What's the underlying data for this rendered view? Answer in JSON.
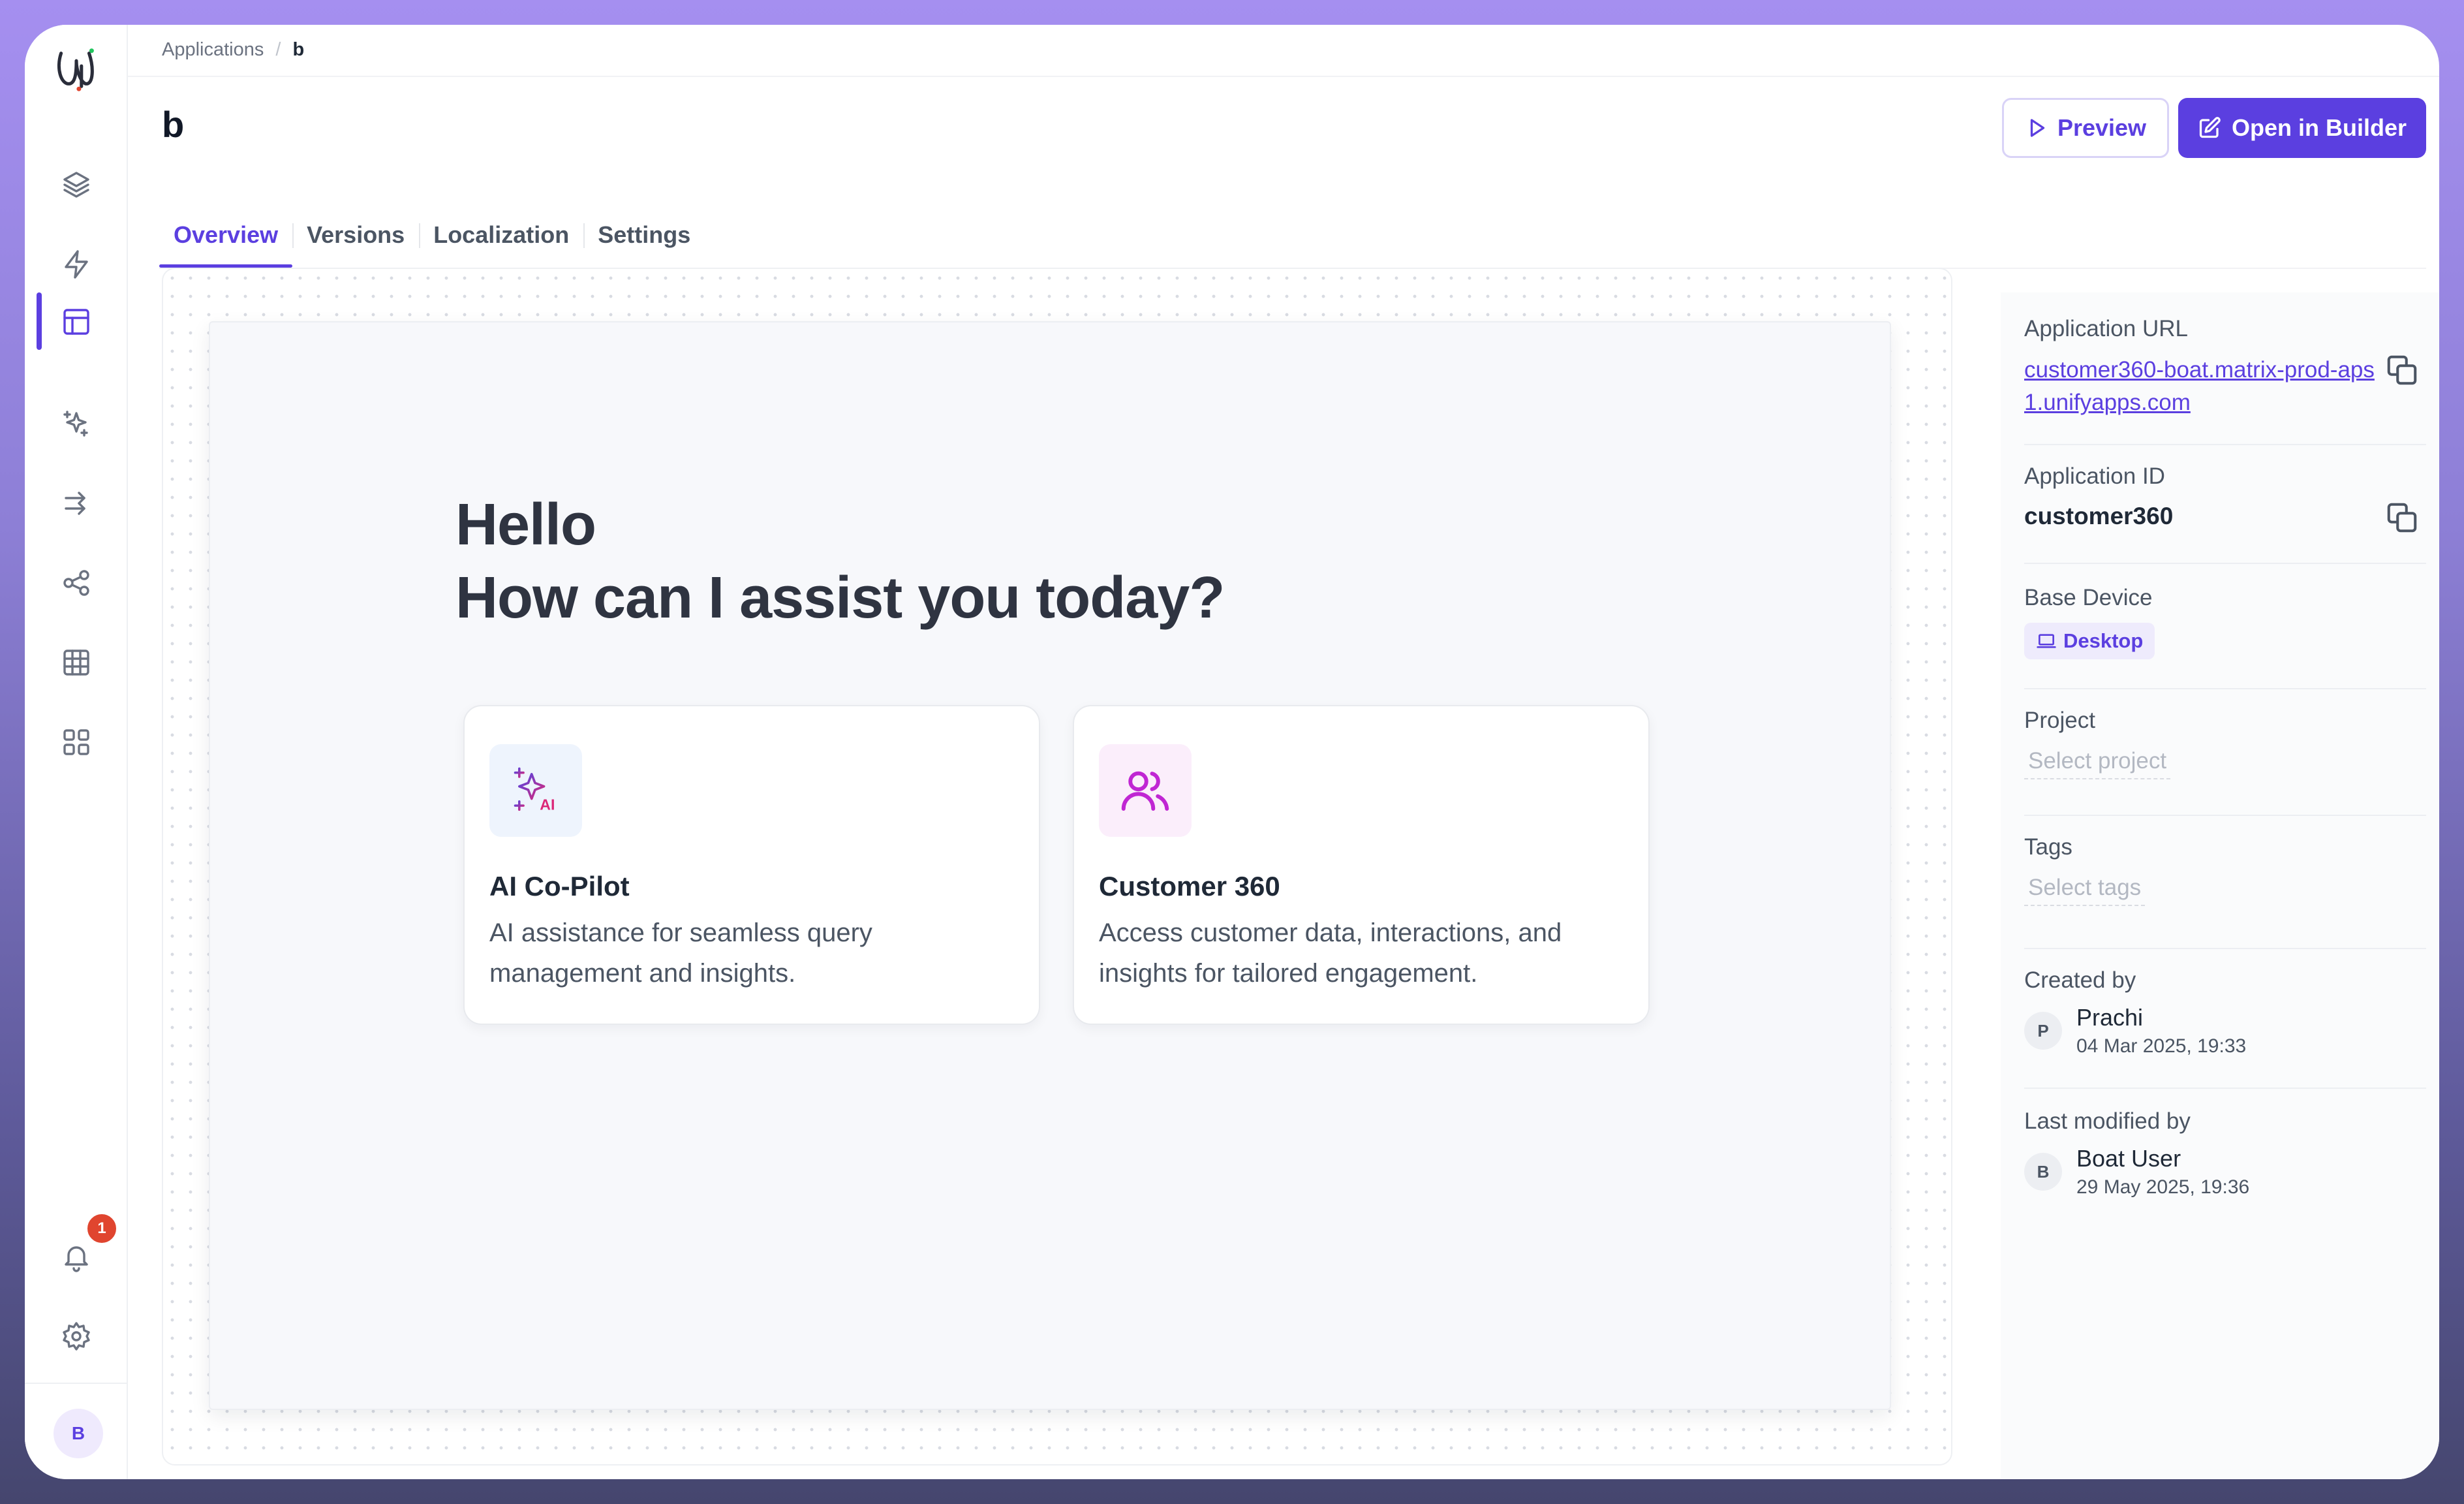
{
  "breadcrumb": {
    "parent": "Applications",
    "separator": "/",
    "current": "b"
  },
  "page": {
    "title": "b"
  },
  "actions": {
    "preview_label": "Preview",
    "open_builder_label": "Open in Builder"
  },
  "tabs": [
    {
      "label": "Overview",
      "active": true
    },
    {
      "label": "Versions",
      "active": false
    },
    {
      "label": "Localization",
      "active": false
    },
    {
      "label": "Settings",
      "active": false
    }
  ],
  "sidebar": {
    "icons": [
      "layers-icon",
      "lightning-icon",
      "layout-icon",
      "sparkles-icon",
      "transfer-icon",
      "share-nodes-icon",
      "table-icon",
      "grid-apps-icon",
      "bell-icon",
      "gear-icon"
    ],
    "notification_count": "1",
    "user_initial": "B"
  },
  "preview": {
    "greeting_line1": "Hello",
    "greeting_line2": "How can I assist you today?",
    "cards": [
      {
        "title": "AI Co-Pilot",
        "description": "AI assistance for seamless query management and insights.",
        "icon": "ai-sparkles-icon",
        "icon_text": "AI"
      },
      {
        "title": "Customer 360",
        "description": "Access customer data, interactions, and insights for tailored engagement.",
        "icon": "users-icon"
      }
    ]
  },
  "details": {
    "url_label": "Application URL",
    "url_value": "customer360-boat.matrix-prod-aps1.unifyapps.com",
    "id_label": "Application ID",
    "id_value": "customer360",
    "device_label": "Base Device",
    "device_value": "Desktop",
    "project_label": "Project",
    "project_placeholder": "Select project",
    "tags_label": "Tags",
    "tags_placeholder": "Select tags",
    "created_label": "Created by",
    "created_initial": "P",
    "created_name": "Prachi",
    "created_date": "04 Mar 2025, 19:33",
    "modified_label": "Last modified by",
    "modified_initial": "B",
    "modified_name": "Boat User",
    "modified_date": "29 May 2025, 19:36"
  },
  "colors": {
    "accent": "#5b3fe0",
    "badge": "#e0452f",
    "ai_icon_gradient": [
      "#4f46e5",
      "#db2777"
    ],
    "users_icon": "#c026d3"
  }
}
